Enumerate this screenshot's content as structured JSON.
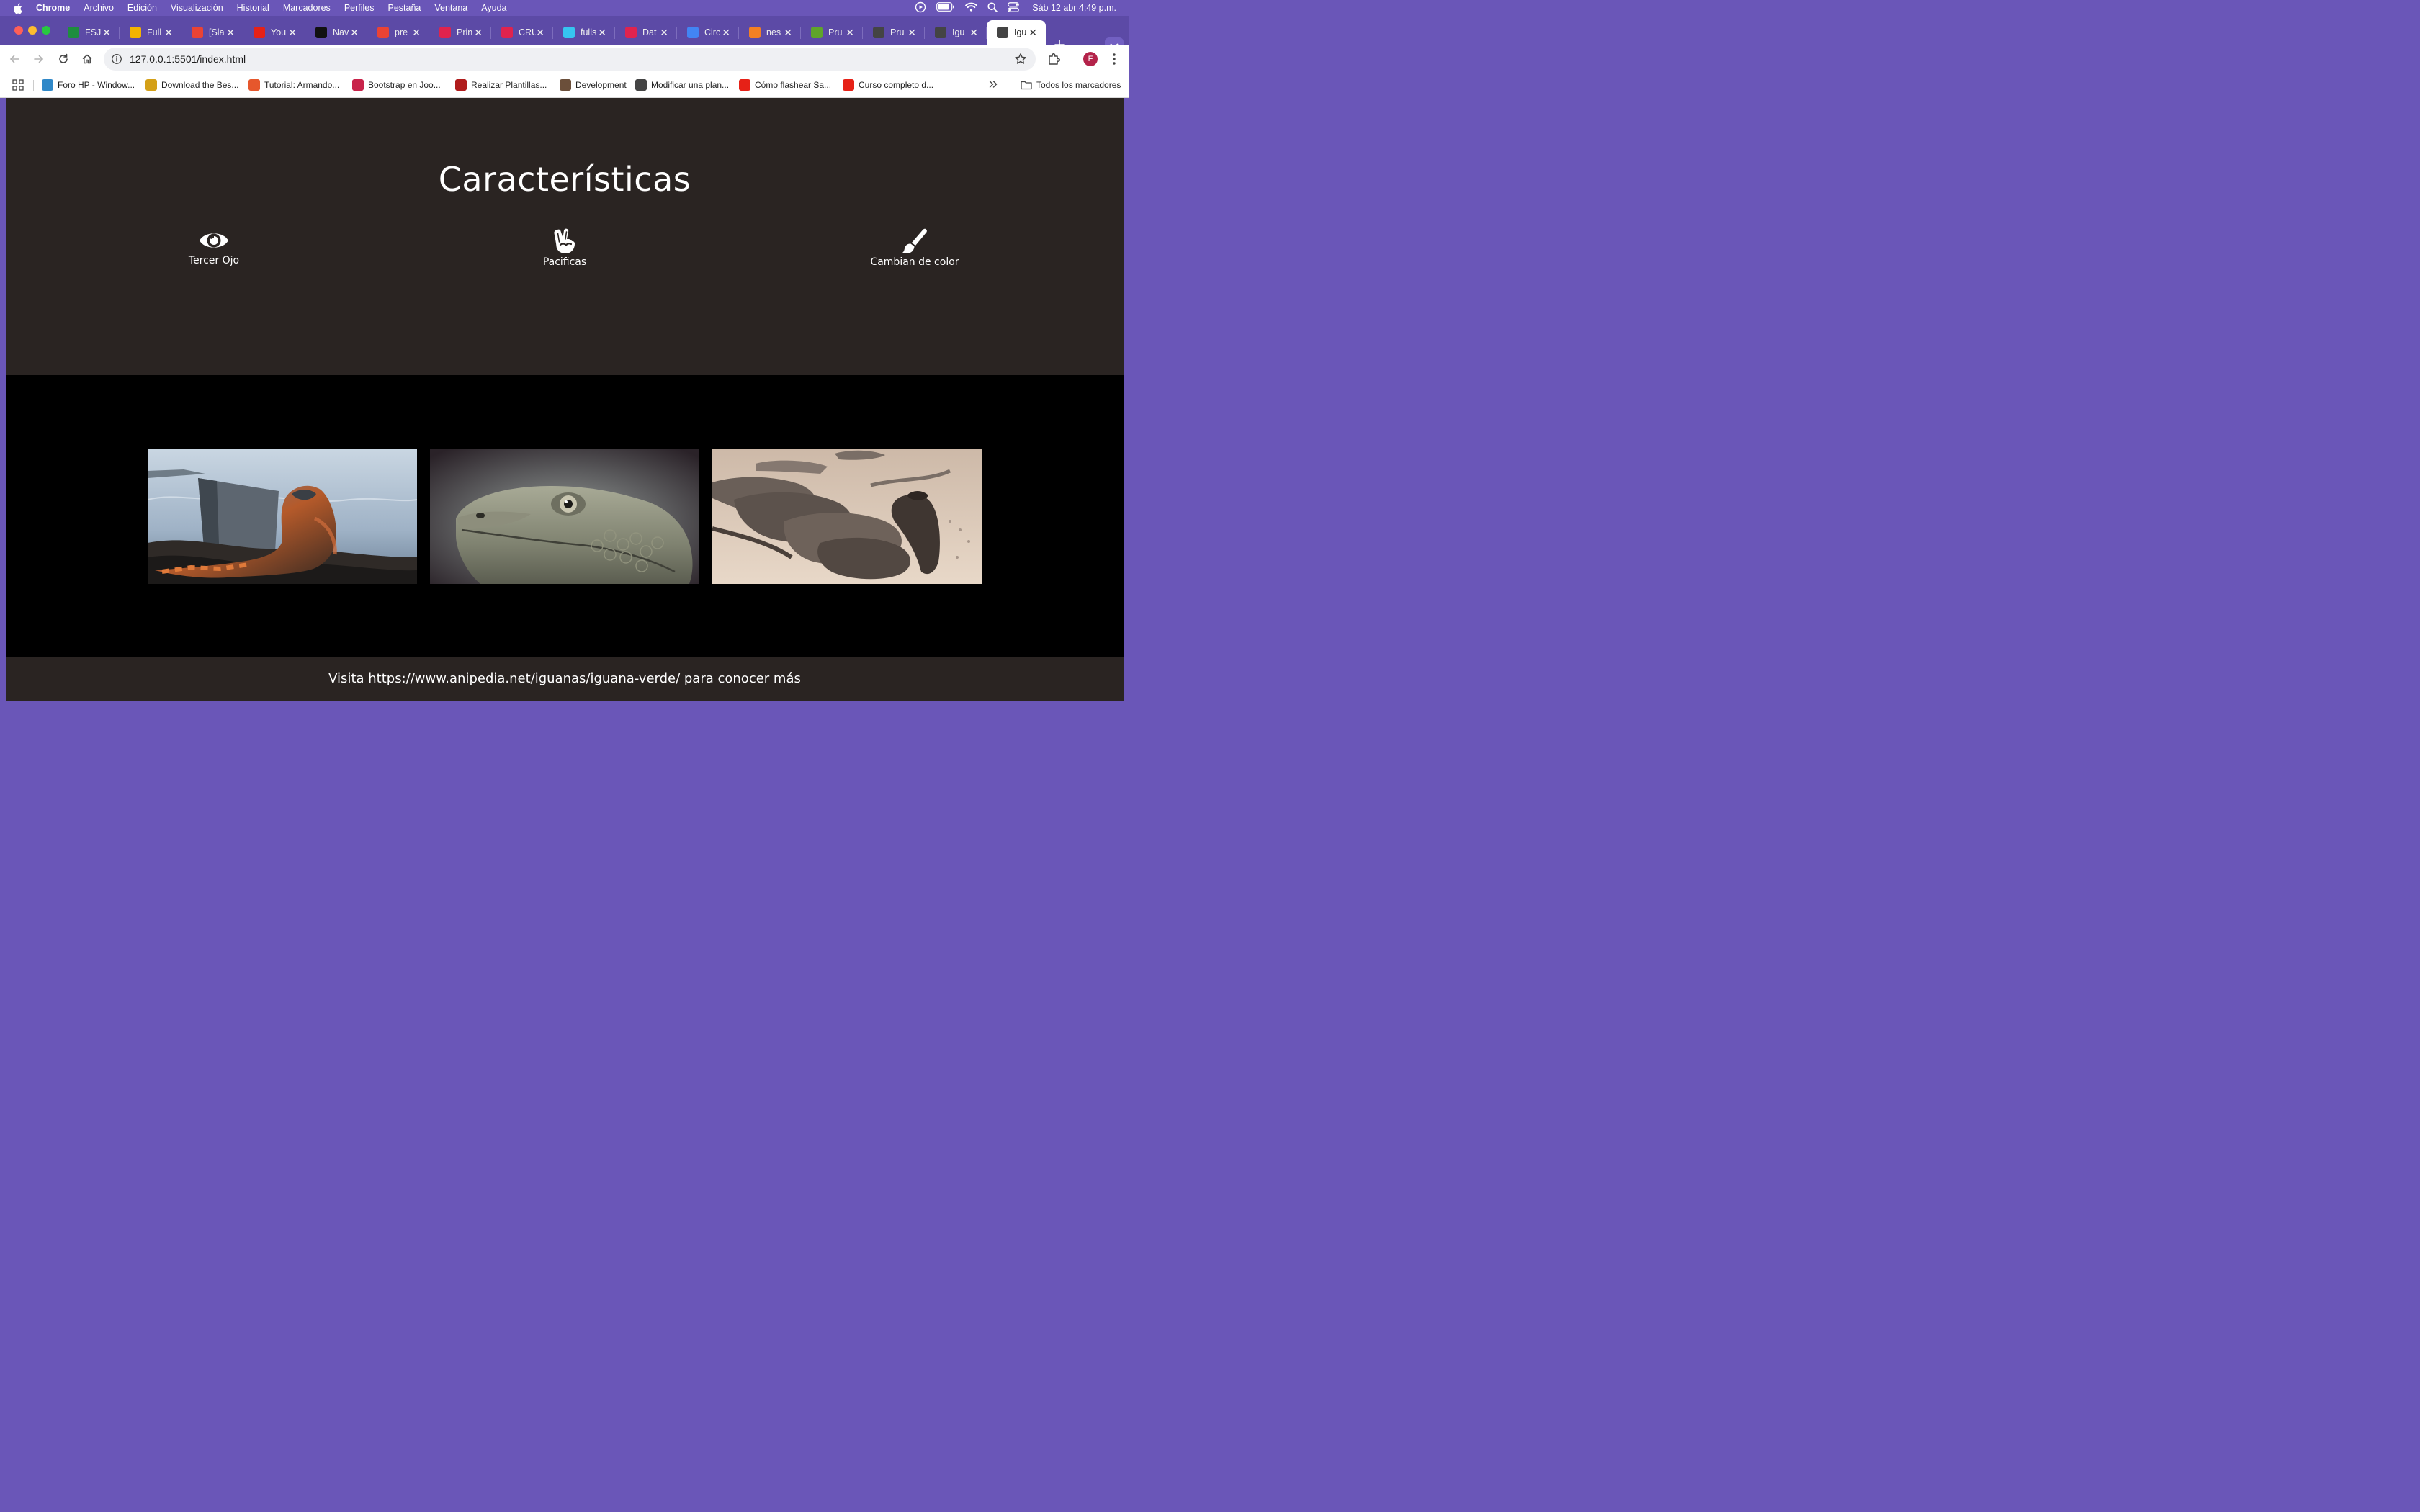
{
  "menubar": {
    "app": "Chrome",
    "items": [
      "Archivo",
      "Edición",
      "Visualización",
      "Historial",
      "Marcadores",
      "Perfiles",
      "Pestaña",
      "Ventana",
      "Ayuda"
    ],
    "clock": "Sáb 12 abr 4:49 p.m."
  },
  "tabs": [
    {
      "title": "FSJ",
      "icon": "sheets-icon",
      "color": "#1e8e3e"
    },
    {
      "title": "Full",
      "icon": "drive-icon",
      "color": "#f4b400"
    },
    {
      "title": "[Sla",
      "icon": "gmail-icon",
      "color": "#ea4335"
    },
    {
      "title": "You",
      "icon": "youtube-icon",
      "color": "#e62117"
    },
    {
      "title": "Nav",
      "icon": "openai-icon",
      "color": "#111111"
    },
    {
      "title": "pre",
      "icon": "gmail-icon",
      "color": "#ea4335"
    },
    {
      "title": "Prin",
      "icon": "nest-icon",
      "color": "#e0234e"
    },
    {
      "title": "CRU",
      "icon": "nest-icon",
      "color": "#e0234e"
    },
    {
      "title": "fulls",
      "icon": "slack-icon",
      "color": "#36c5f0"
    },
    {
      "title": "Dat",
      "icon": "nest-icon",
      "color": "#e0234e"
    },
    {
      "title": "Circ",
      "icon": "google-icon",
      "color": "#4285f4"
    },
    {
      "title": "nes",
      "icon": "stackoverflow-icon",
      "color": "#f48024"
    },
    {
      "title": "Pru",
      "icon": "jsfiddle-icon",
      "color": "#5fa52a"
    },
    {
      "title": "Pru",
      "icon": "globe-icon",
      "color": "#444444"
    },
    {
      "title": "Igu",
      "icon": "globe-icon",
      "color": "#444444"
    },
    {
      "title": "Igu",
      "icon": "globe-icon",
      "color": "#444444",
      "active": true
    }
  ],
  "address": {
    "url": "127.0.0.1:5501/index.html"
  },
  "bookmarks": [
    {
      "label": "Foro HP - Window...",
      "icon": "hp-icon"
    },
    {
      "label": "Download the Bes...",
      "icon": "jie-icon"
    },
    {
      "label": "Tutorial: Armando...",
      "icon": "joomla-icon"
    },
    {
      "label": "Bootstrap en Joo...",
      "icon": "bookmark-w-icon"
    },
    {
      "label": "Realizar Plantillas...",
      "icon": "sj-icon"
    },
    {
      "label": "Development",
      "icon": "dev-icon"
    },
    {
      "label": "Modificar una plan...",
      "icon": "globe-icon"
    },
    {
      "label": "Cómo flashear Sa...",
      "icon": "youtube-icon"
    },
    {
      "label": "Curso completo d...",
      "icon": "youtube-icon"
    }
  ],
  "bookmarks_all": "Todos los marcadores",
  "page": {
    "heading": "Características",
    "features": [
      {
        "label": "Tercer Ojo",
        "icon": "eye-icon"
      },
      {
        "label": "Pacificas",
        "icon": "peace-hand-icon"
      },
      {
        "label": "Cambian de color",
        "icon": "paintbrush-icon"
      }
    ],
    "gallery": [
      {
        "alt": "iguana-rock-sea-photo"
      },
      {
        "alt": "iguana-head-closeup-photo"
      },
      {
        "alt": "iguanas-on-sand-photo"
      }
    ],
    "footer": "Visita https://www.anipedia.net/iguanas/iguana-verde/ para conocer más"
  },
  "colors": {
    "section_bg": "#2a2422",
    "gallery_bg": "#000000",
    "chrome_frame": "#6a56b8"
  }
}
